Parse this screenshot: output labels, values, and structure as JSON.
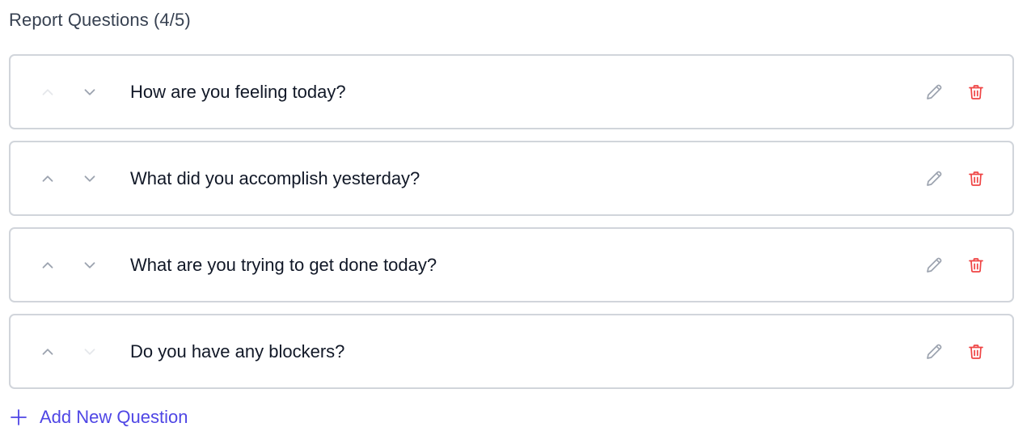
{
  "section": {
    "title": "Report Questions (4/5)"
  },
  "questions": [
    {
      "text": "How are you feeling today?",
      "up_enabled": false,
      "down_enabled": true
    },
    {
      "text": "What did you accomplish yesterday?",
      "up_enabled": true,
      "down_enabled": true
    },
    {
      "text": "What are you trying to get done today?",
      "up_enabled": true,
      "down_enabled": true
    },
    {
      "text": "Do you have any blockers?",
      "up_enabled": true,
      "down_enabled": false
    }
  ],
  "add_question": {
    "label": "Add New Question"
  },
  "icons": {
    "move_up": "chevron-up-icon",
    "move_down": "chevron-down-icon",
    "edit": "pencil-icon",
    "delete": "trash-icon",
    "add": "plus-icon"
  },
  "colors": {
    "accent": "#4f46e5",
    "delete": "#ef4444",
    "edit": "#9ca3af",
    "border": "#d1d5db"
  }
}
